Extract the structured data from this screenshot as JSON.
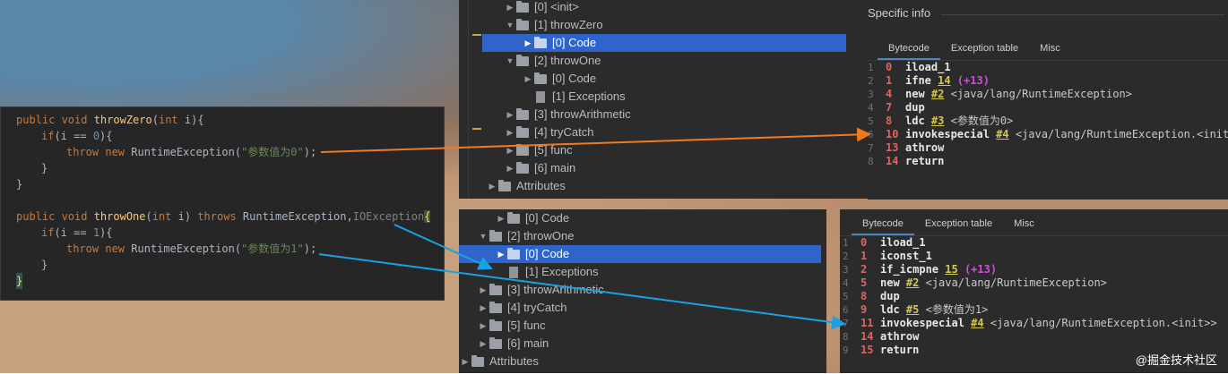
{
  "top_tree": {
    "items": [
      {
        "label": "[0] <init>",
        "indent": 1,
        "arrow": "right",
        "icon": "folder",
        "selected": false
      },
      {
        "label": "[1] throwZero",
        "indent": 1,
        "arrow": "down",
        "icon": "folder",
        "selected": false
      },
      {
        "label": "[0] Code",
        "indent": 2,
        "arrow": "right",
        "icon": "folder",
        "selected": true
      },
      {
        "label": "[2] throwOne",
        "indent": 1,
        "arrow": "down",
        "icon": "folder",
        "selected": false
      },
      {
        "label": "[0] Code",
        "indent": 2,
        "arrow": "right",
        "icon": "folder",
        "selected": false
      },
      {
        "label": "[1] Exceptions",
        "indent": 2,
        "arrow": "none",
        "icon": "file",
        "selected": false
      },
      {
        "label": "[3] throwArithmetic",
        "indent": 1,
        "arrow": "right",
        "icon": "folder",
        "selected": false
      },
      {
        "label": "[4] tryCatch",
        "indent": 1,
        "arrow": "right",
        "icon": "folder",
        "selected": false
      },
      {
        "label": "[5] func",
        "indent": 1,
        "arrow": "right",
        "icon": "folder",
        "selected": false
      },
      {
        "label": "[6] main",
        "indent": 1,
        "arrow": "right",
        "icon": "folder",
        "selected": false
      },
      {
        "label": "Attributes",
        "indent": 0,
        "arrow": "right",
        "icon": "folder",
        "selected": false
      }
    ]
  },
  "top_info": {
    "heading": "Specific info",
    "tabs": [
      "Bytecode",
      "Exception table",
      "Misc"
    ],
    "active_tab": "Bytecode"
  },
  "top_bytecode": [
    {
      "ln": "1",
      "off": "0",
      "op": "iload_1",
      "ref": "",
      "rel": "",
      "cmt": ""
    },
    {
      "ln": "2",
      "off": "1",
      "op": "ifne",
      "ref": "14",
      "rel": "(+13)",
      "cmt": ""
    },
    {
      "ln": "3",
      "off": "4",
      "op": "new",
      "ref": "#2",
      "rel": "",
      "cmt": "<java/lang/RuntimeException>"
    },
    {
      "ln": "4",
      "off": "7",
      "op": "dup",
      "ref": "",
      "rel": "",
      "cmt": ""
    },
    {
      "ln": "5",
      "off": "8",
      "op": "ldc",
      "ref": "#3",
      "rel": "",
      "cmt": "<参数值为0>"
    },
    {
      "ln": "6",
      "off": "10",
      "op": "invokespecial",
      "ref": "#4",
      "rel": "",
      "cmt": "<java/lang/RuntimeException.<init>>"
    },
    {
      "ln": "7",
      "off": "13",
      "op": "athrow",
      "ref": "",
      "rel": "",
      "cmt": ""
    },
    {
      "ln": "8",
      "off": "14",
      "op": "return",
      "ref": "",
      "rel": "",
      "cmt": ""
    }
  ],
  "bottom_tree": {
    "items": [
      {
        "label": "[0] Code",
        "indent": 2,
        "arrow": "right",
        "icon": "folder",
        "selected": false
      },
      {
        "label": "[2] throwOne",
        "indent": 1,
        "arrow": "down",
        "icon": "folder",
        "selected": false
      },
      {
        "label": "[0] Code",
        "indent": 2,
        "arrow": "right",
        "icon": "folder",
        "selected": true
      },
      {
        "label": "[1] Exceptions",
        "indent": 2,
        "arrow": "none",
        "icon": "file",
        "selected": false
      },
      {
        "label": "[3] throwArithmetic",
        "indent": 1,
        "arrow": "right",
        "icon": "folder",
        "selected": false
      },
      {
        "label": "[4] tryCatch",
        "indent": 1,
        "arrow": "right",
        "icon": "folder",
        "selected": false
      },
      {
        "label": "[5] func",
        "indent": 1,
        "arrow": "right",
        "icon": "folder",
        "selected": false
      },
      {
        "label": "[6] main",
        "indent": 1,
        "arrow": "right",
        "icon": "folder",
        "selected": false
      },
      {
        "label": "Attributes",
        "indent": 0,
        "arrow": "right",
        "icon": "folder",
        "selected": false
      }
    ]
  },
  "bottom_info": {
    "tabs": [
      "Bytecode",
      "Exception table",
      "Misc"
    ],
    "active_tab": "Bytecode"
  },
  "bottom_bytecode": [
    {
      "ln": "1",
      "off": "0",
      "op": "iload_1",
      "ref": "",
      "rel": "",
      "cmt": ""
    },
    {
      "ln": "2",
      "off": "1",
      "op": "iconst_1",
      "ref": "",
      "rel": "",
      "cmt": ""
    },
    {
      "ln": "3",
      "off": "2",
      "op": "if_icmpne",
      "ref": "15",
      "rel": "(+13)",
      "cmt": ""
    },
    {
      "ln": "4",
      "off": "5",
      "op": "new",
      "ref": "#2",
      "rel": "",
      "cmt": "<java/lang/RuntimeException>"
    },
    {
      "ln": "5",
      "off": "8",
      "op": "dup",
      "ref": "",
      "rel": "",
      "cmt": ""
    },
    {
      "ln": "6",
      "off": "9",
      "op": "ldc",
      "ref": "#5",
      "rel": "",
      "cmt": "<参数值为1>"
    },
    {
      "ln": "7",
      "off": "11",
      "op": "invokespecial",
      "ref": "#4",
      "rel": "",
      "cmt": "<java/lang/RuntimeException.<init>>"
    },
    {
      "ln": "8",
      "off": "14",
      "op": "athrow",
      "ref": "",
      "rel": "",
      "cmt": ""
    },
    {
      "ln": "9",
      "off": "15",
      "op": "return",
      "ref": "",
      "rel": "",
      "cmt": ""
    }
  ],
  "source": {
    "l1": {
      "kw1": "public void ",
      "fn": "throwZero",
      "p1": "(",
      "kw2": "int ",
      "p2": "i){"
    },
    "l2": {
      "kw": "if",
      "p1": "(i == ",
      "num": "0",
      "p2": "){"
    },
    "l3": {
      "kw": "throw new ",
      "cls": "RuntimeException(",
      "str": "\"参数值为0\"",
      "p": ");"
    },
    "l4": "}",
    "l5": "}",
    "l6": {
      "kw1": "public void ",
      "fn": "throwOne",
      "p1": "(",
      "kw2": "int ",
      "p2": "i) ",
      "kw3": "throws ",
      "cls": "RuntimeException,",
      "exc": "IOException",
      "brace": "{"
    },
    "l7": {
      "kw": "if",
      "p1": "(i == ",
      "num": "1",
      "p2": "){"
    },
    "l8": {
      "kw": "throw new ",
      "cls": "RuntimeException(",
      "str": "\"参数值为1\"",
      "p": ");"
    },
    "l9": "}",
    "l10": "}"
  },
  "arrow_colors": {
    "orange": "#f07a1e",
    "blue": "#1aa0e6"
  },
  "watermark": "@掘金技术社区"
}
